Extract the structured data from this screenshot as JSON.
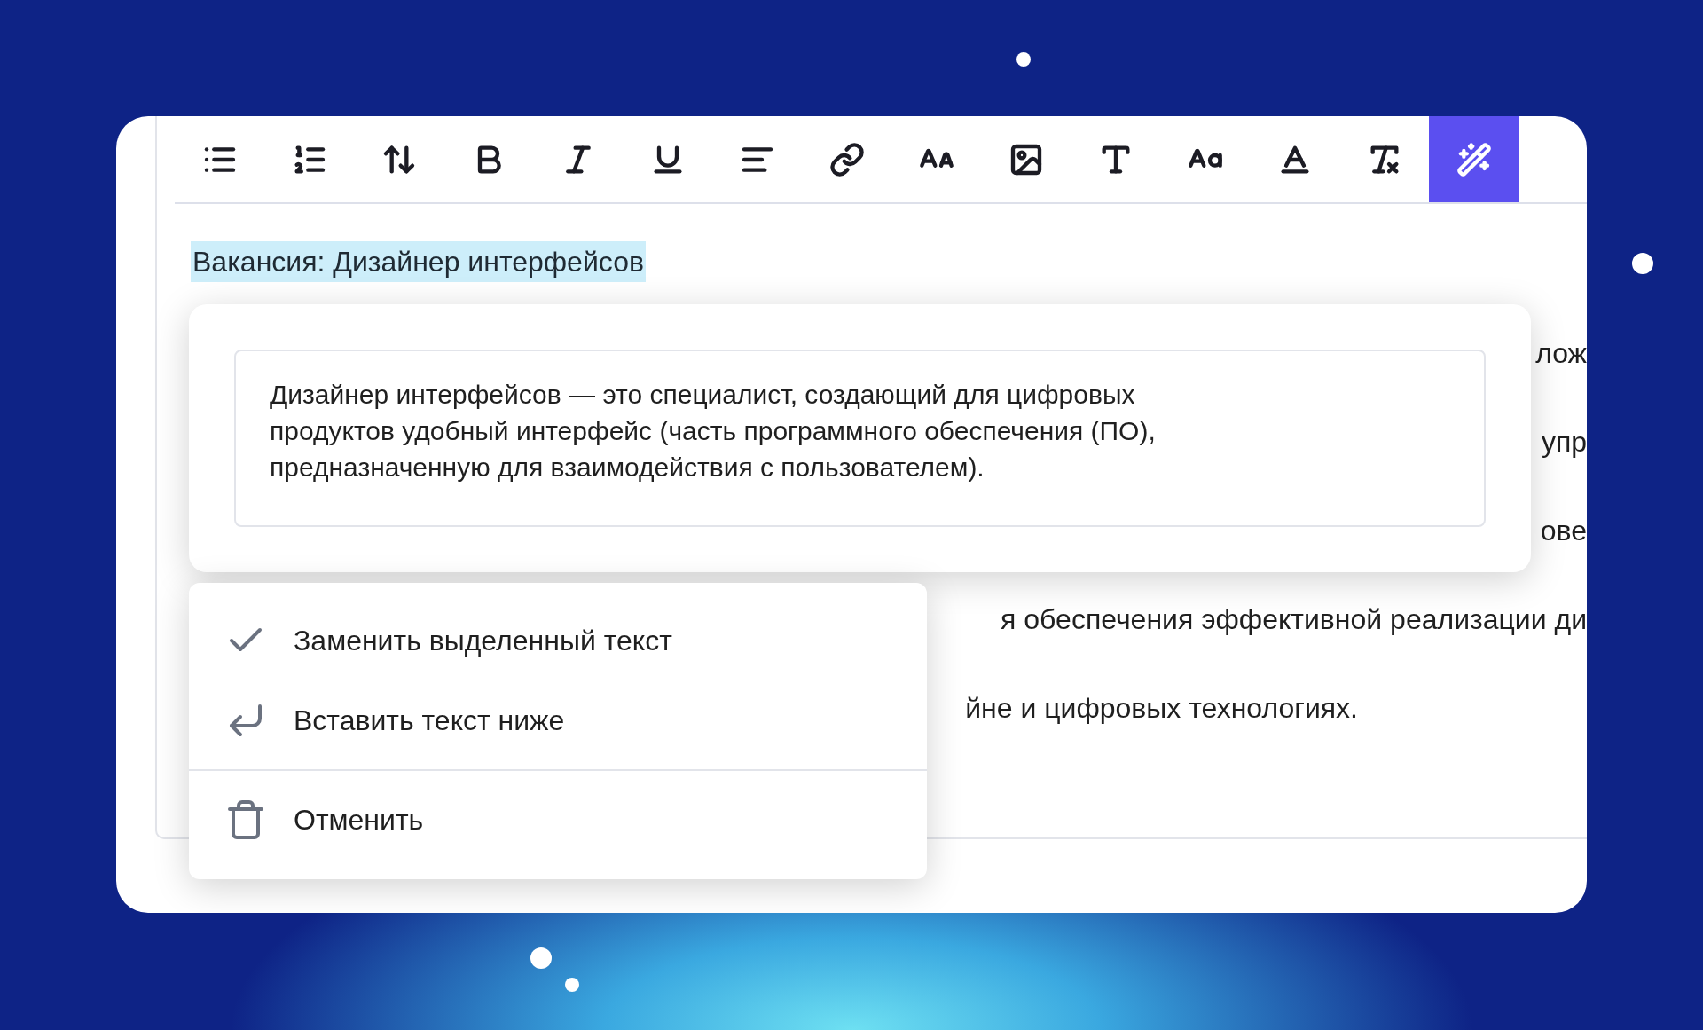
{
  "toolbar": {
    "buttons": [
      {
        "kind": "bullets",
        "selected": false
      },
      {
        "kind": "numbers",
        "selected": false
      },
      {
        "kind": "spacing",
        "selected": false
      },
      {
        "kind": "bold",
        "selected": false
      },
      {
        "kind": "italic",
        "selected": false
      },
      {
        "kind": "underline",
        "selected": false
      },
      {
        "kind": "align",
        "selected": false
      },
      {
        "kind": "link",
        "selected": false
      },
      {
        "kind": "fontsize",
        "selected": false
      },
      {
        "kind": "image",
        "selected": false
      },
      {
        "kind": "font",
        "selected": false
      },
      {
        "kind": "case",
        "selected": false
      },
      {
        "kind": "color",
        "selected": false
      },
      {
        "kind": "clear",
        "selected": false
      },
      {
        "kind": "ai",
        "selected": true
      }
    ]
  },
  "editor": {
    "title": {
      "text": "Вакансия: Дизайнер интерфейсов",
      "selected": true
    },
    "lines": [
      "лож",
      "упр",
      "ове",
      "я обеспечения эффективной реализации ди",
      "йне и цифровых технологиях."
    ]
  },
  "ai_result": {
    "text": "Дизайнер интерфейсов — это специалист, создающий для цифровых продуктов удобный интерфейс (часть программного обеспечения (ПО), предназначенную для взаимодействия с пользователем)."
  },
  "menu": {
    "items": [
      {
        "kind": "replace",
        "label": "Заменить выделенный текст"
      },
      {
        "kind": "insert",
        "label": "Вставить текст ниже"
      },
      {
        "kind": "cancel",
        "label": "Отменить"
      }
    ]
  }
}
